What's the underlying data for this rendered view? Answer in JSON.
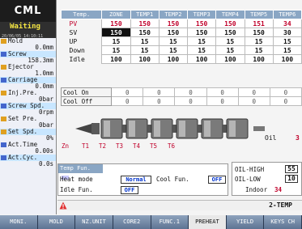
{
  "sidebar": {
    "logo": "CML",
    "status": "Waiting",
    "timestamp": "20/06/05 14:10:11",
    "items": [
      {
        "label": "Mold",
        "value": "0.0mm"
      },
      {
        "label": "Screw",
        "value": "158.3mm"
      },
      {
        "label": "Ejector",
        "value": "1.0mm"
      },
      {
        "label": "Carriage",
        "value": "0.0mm"
      },
      {
        "label": "Inj.Pre.",
        "value": "0bar"
      },
      {
        "label": "Screw Spd.",
        "value": "0rpm"
      },
      {
        "label": "Set Pre.",
        "value": "0bar"
      },
      {
        "label": "Set Spd.",
        "value": "0%"
      },
      {
        "label": "Act.Time",
        "value": "0.00s"
      },
      {
        "label": "Act.Cyc.",
        "value": "0.0s"
      }
    ]
  },
  "temp_table": {
    "headers": [
      "Temp.",
      "ZONE",
      "TEMP1",
      "TEMP2",
      "TEMP3",
      "TEMP4",
      "TEMP5",
      "TEMP6"
    ],
    "rows": [
      {
        "label": "PV",
        "values": [
          "150",
          "150",
          "150",
          "150",
          "150",
          "151",
          "34"
        ]
      },
      {
        "label": "SV",
        "values": [
          "150",
          "150",
          "150",
          "150",
          "150",
          "150",
          "30"
        ]
      },
      {
        "label": "UP",
        "values": [
          "15",
          "15",
          "15",
          "15",
          "15",
          "15",
          "15"
        ]
      },
      {
        "label": "Down",
        "values": [
          "15",
          "15",
          "15",
          "15",
          "15",
          "15",
          "15"
        ]
      },
      {
        "label": "Idle",
        "values": [
          "100",
          "100",
          "100",
          "100",
          "100",
          "100",
          "100"
        ]
      }
    ]
  },
  "cool_table": {
    "rows": [
      {
        "label": "Cool On",
        "values": [
          "0",
          "0",
          "0",
          "0",
          "0",
          "0"
        ]
      },
      {
        "label": "Cool Off",
        "values": [
          "0",
          "0",
          "0",
          "0",
          "0",
          "0"
        ]
      }
    ]
  },
  "barrel": {
    "zones": [
      "Zn",
      "T1",
      "T2",
      "T3",
      "T4",
      "T5",
      "T6"
    ],
    "oil_label": "Oil",
    "oil_value": "3"
  },
  "temp_fun": {
    "title": "Temp Fun.",
    "heat_mode_label": "Heat mode",
    "heat_mode_value": "Normal",
    "cool_fun_label": "Cool Fun.",
    "cool_fun_value": "OFF",
    "idle_fun_label": "Idle Fun.",
    "idle_fun_value": "OFF"
  },
  "oil_panel": {
    "high_label": "OIL-HIGH",
    "high_value": "55",
    "low_label": "OIL-LOW",
    "low_value": "10",
    "indoor_label": "Indoor",
    "indoor_value": "34"
  },
  "alarm": {
    "page": "2-TEMP"
  },
  "tabs": [
    "MONI.",
    "MOLD",
    "NZ.UNIT",
    "CORE2",
    "FUNC.1",
    "PREHEAT",
    "YIELD",
    "KEYS CH"
  ],
  "active_tab": "PREHEAT",
  "colors": {
    "header": "#8aa6c4",
    "pv": "#c0002a",
    "tabbar": "#6f86a3"
  }
}
